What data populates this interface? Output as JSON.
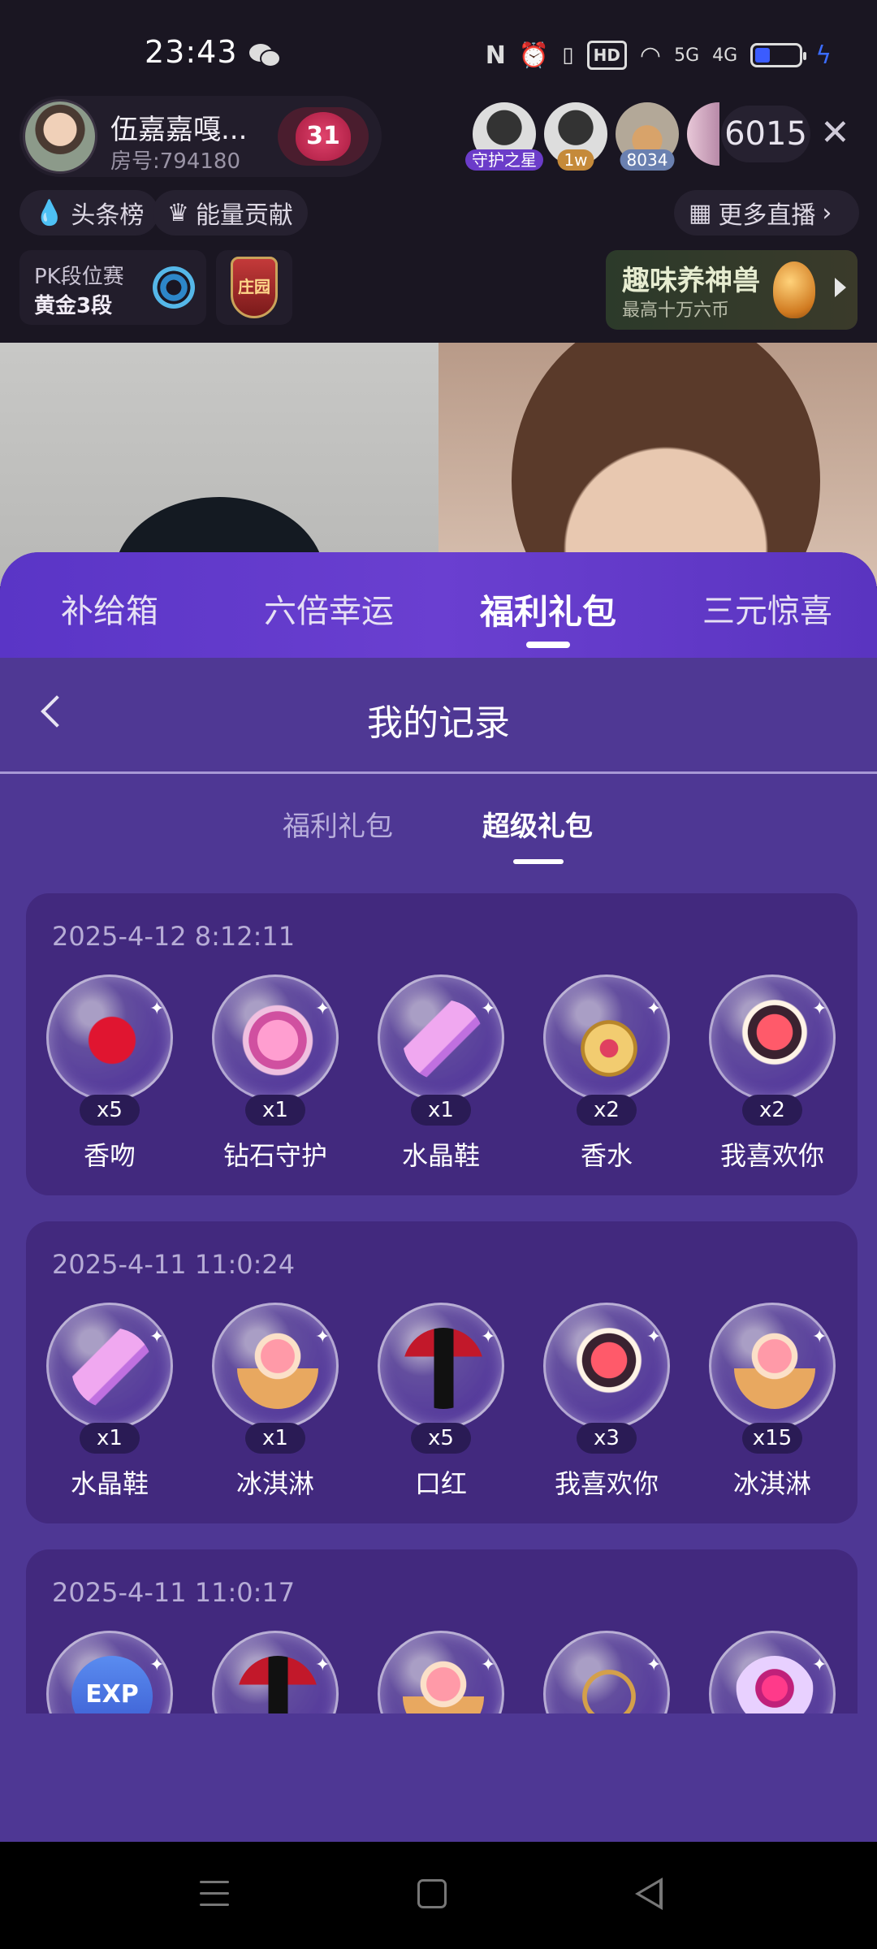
{
  "status_bar": {
    "time": "23:43",
    "network_chip": "HD",
    "net_5g": "5G",
    "net_4g": "4G",
    "battery_color": "#3b5cff"
  },
  "anchor": {
    "name": "伍嘉嘉嘎...",
    "room_no": "房号:794180",
    "heart_level": "31"
  },
  "viewers": {
    "badges": [
      "守护之星",
      "1w",
      "8034"
    ],
    "count": "6015"
  },
  "chips": {
    "toplist": "头条榜",
    "energy": "能量贡献",
    "more_live": "更多直播"
  },
  "pk": {
    "title": "PK段位赛",
    "rank": "黄金3段",
    "shield_text": "庄园"
  },
  "pet": {
    "title": "趣味养神兽",
    "subtitle": "最高十万六币"
  },
  "tabs": [
    {
      "label": "补给箱"
    },
    {
      "label": "六倍幸运"
    },
    {
      "label": "福利礼包",
      "active": true
    },
    {
      "label": "三元惊喜"
    }
  ],
  "records_page": {
    "title": "我的记录",
    "subtabs": [
      {
        "label": "福利礼包"
      },
      {
        "label": "超级礼包",
        "active": true
      }
    ]
  },
  "records": [
    {
      "date": "2025-4-12 8:12:11",
      "gifts": [
        {
          "name": "香吻",
          "qty": "x5",
          "icon": "kiss-icon"
        },
        {
          "name": "钻石守护",
          "qty": "x1",
          "icon": "diamond-guard-icon"
        },
        {
          "name": "水晶鞋",
          "qty": "x1",
          "icon": "crystal-shoe-icon"
        },
        {
          "name": "香水",
          "qty": "x2",
          "icon": "perfume-icon"
        },
        {
          "name": "我喜欢你",
          "qty": "x2",
          "icon": "rose-box-icon"
        }
      ]
    },
    {
      "date": "2025-4-11 11:0:24",
      "gifts": [
        {
          "name": "水晶鞋",
          "qty": "x1",
          "icon": "crystal-shoe-icon"
        },
        {
          "name": "冰淇淋",
          "qty": "x1",
          "icon": "ice-cream-icon"
        },
        {
          "name": "口红",
          "qty": "x5",
          "icon": "lipstick-icon"
        },
        {
          "name": "我喜欢你",
          "qty": "x3",
          "icon": "rose-box-icon"
        },
        {
          "name": "冰淇淋",
          "qty": "x15",
          "icon": "ice-cream-icon"
        }
      ]
    },
    {
      "date": "2025-4-11 11:0:17",
      "gifts": [
        {
          "name": "",
          "qty": "",
          "icon": "exp-icon",
          "label": "EXP"
        },
        {
          "name": "",
          "qty": "",
          "icon": "lipstick-icon"
        },
        {
          "name": "",
          "qty": "",
          "icon": "ice-cream-icon"
        },
        {
          "name": "",
          "qty": "",
          "icon": "bracelet-icon"
        },
        {
          "name": "",
          "qty": "",
          "icon": "bow-gift-icon"
        }
      ]
    }
  ],
  "colors": {
    "sheet_bg": "#4e3794",
    "card_bg": "#42297e",
    "tab_bar": "#6a3fd0"
  }
}
